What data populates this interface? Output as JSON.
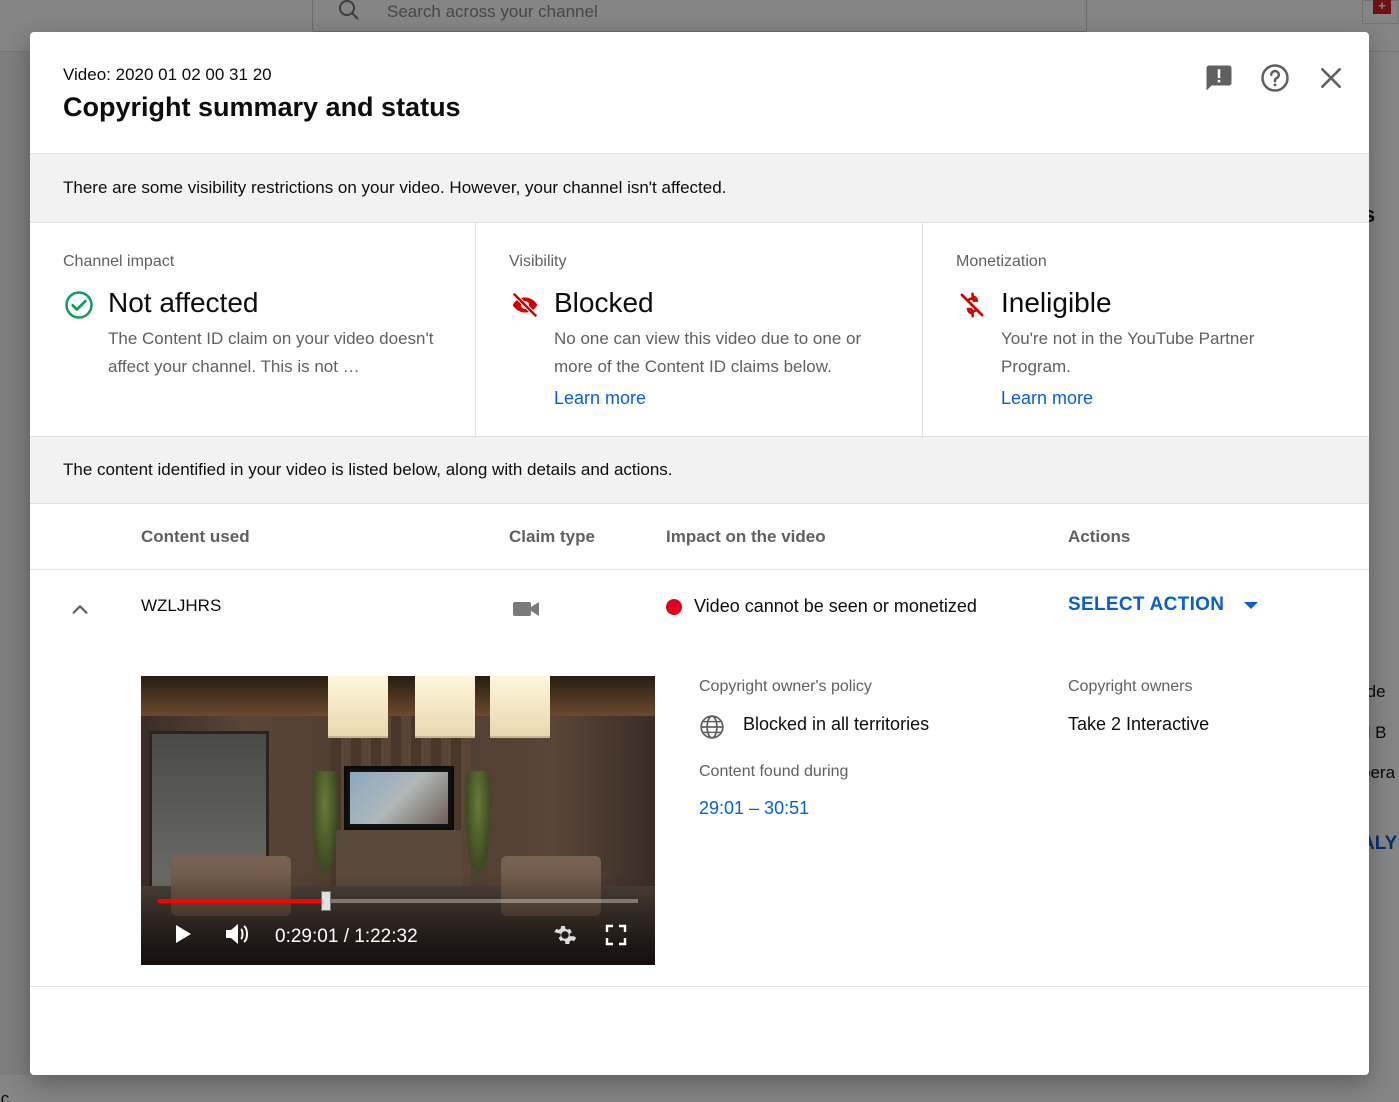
{
  "background": {
    "search_placeholder": "Search across your channel",
    "right_fragments": [
      "s",
      "rde",
      "d B",
      "pera",
      "ALY"
    ],
    "bottom_fragments": [
      "ic"
    ]
  },
  "header": {
    "video_label": "Video: 2020 01 02 00 31 20",
    "title": "Copyright summary and status",
    "icons": [
      "feedback-icon",
      "help-icon",
      "close-icon"
    ]
  },
  "banner_top": "There are some visibility restrictions on your video. However, your channel isn't affected.",
  "cards": [
    {
      "label": "Channel impact",
      "status": "Not affected",
      "icon": "check-circle-icon",
      "icon_color": "#0f9d58",
      "description": "The Content ID claim on your video doesn't affect your channel. This is not …",
      "link": ""
    },
    {
      "label": "Visibility",
      "status": "Blocked",
      "icon": "visibility-off-icon",
      "icon_color": "#cc0000",
      "description": "No one can view this video due to one or more of the Content ID claims below.",
      "link": "Learn more"
    },
    {
      "label": "Monetization",
      "status": "Ineligible",
      "icon": "money-off-icon",
      "icon_color": "#cc0000",
      "description": "You're not in the YouTube Partner Program.",
      "link": "Learn more"
    }
  ],
  "banner_bottom": "The content identified in your video is listed below, along with details and actions.",
  "table": {
    "headers": {
      "content_used": "Content used",
      "claim_type": "Claim type",
      "impact": "Impact on the video",
      "actions": "Actions"
    },
    "rows": [
      {
        "content_used": "WZLJHRS",
        "claim_type_icon": "videocam-icon",
        "impact": "Video cannot be seen or monetized",
        "impact_color": "#e1001d",
        "action": "SELECT ACTION",
        "player": {
          "current_time": "0:29:01",
          "duration": "1:22:32",
          "progress": 0.35
        },
        "details": {
          "policy_label": "Copyright owner's policy",
          "policy_value": "Blocked in all territories",
          "owners_label": "Copyright owners",
          "owners_value": "Take 2 Interactive",
          "found_label": "Content found during",
          "found_value": "29:01 – 30:51"
        }
      }
    ]
  },
  "colors": {
    "link": "#065fd4",
    "secondary_text": "#606060",
    "banner_bg": "#f2f2f2",
    "progress": "#ff0000"
  }
}
